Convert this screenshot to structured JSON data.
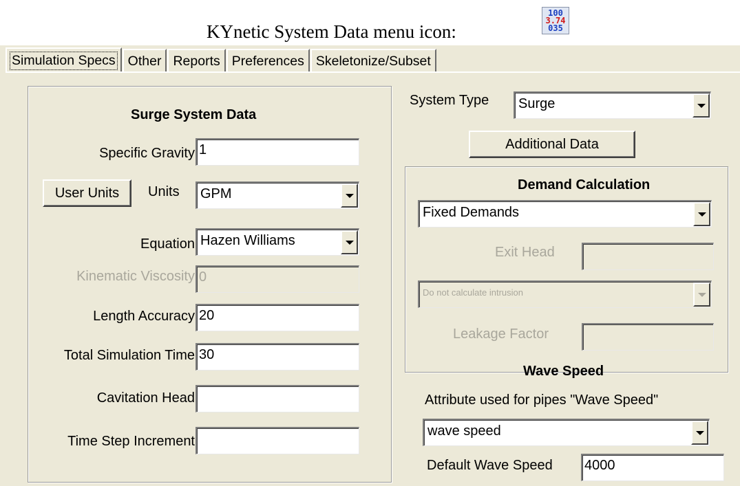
{
  "caption": {
    "text": "KYnetic System Data menu icon:",
    "icon": {
      "name": "kynetic-system-data-icon",
      "lines": [
        "100",
        "3.74",
        "035"
      ]
    }
  },
  "tabs": [
    {
      "label": "Simulation Specs",
      "active": true
    },
    {
      "label": "Other"
    },
    {
      "label": "Reports"
    },
    {
      "label": "Preferences"
    },
    {
      "label": "Skeletonize/Subset"
    }
  ],
  "surge_group": {
    "title": "Surge System Data",
    "specific_gravity": {
      "label": "Specific Gravity",
      "value": "1"
    },
    "user_units_button": "User Units",
    "units": {
      "label": "Units",
      "value": "GPM"
    },
    "equation": {
      "label": "Equation",
      "value": "Hazen Williams"
    },
    "kinematic_viscosity": {
      "label": "Kinematic Viscosity",
      "value": "0",
      "disabled": true
    },
    "length_accuracy": {
      "label": "Length Accuracy",
      "value": "20"
    },
    "total_simulation_time": {
      "label": "Total Simulation Time",
      "value": "30"
    },
    "cavitation_head": {
      "label": "Cavitation Head",
      "value": ""
    },
    "time_step_increment": {
      "label": "Time Step Increment",
      "value": ""
    }
  },
  "system_type": {
    "label": "System Type",
    "value": "Surge"
  },
  "additional_data_button": "Additional Data",
  "demand_group": {
    "title": "Demand Calculation",
    "mode": "Fixed Demands",
    "exit_head": {
      "label": "Exit Head",
      "value": "",
      "disabled": true
    },
    "intrusion": {
      "value": "Do not calculate intrusion",
      "disabled": true
    },
    "leakage_factor": {
      "label": "Leakage Factor",
      "value": "",
      "disabled": true
    }
  },
  "wave_speed": {
    "title": "Wave Speed",
    "attribute_label": "Attribute used for pipes \"Wave Speed\"",
    "attribute_value": "wave speed",
    "default_label": "Default Wave Speed",
    "default_value": "4000"
  },
  "colors": {
    "dialog_bg": "#ece9d8",
    "disabled_text": "#a9a79c",
    "icon_blue": "#1a3fbf",
    "icon_red": "#d11a1a"
  }
}
